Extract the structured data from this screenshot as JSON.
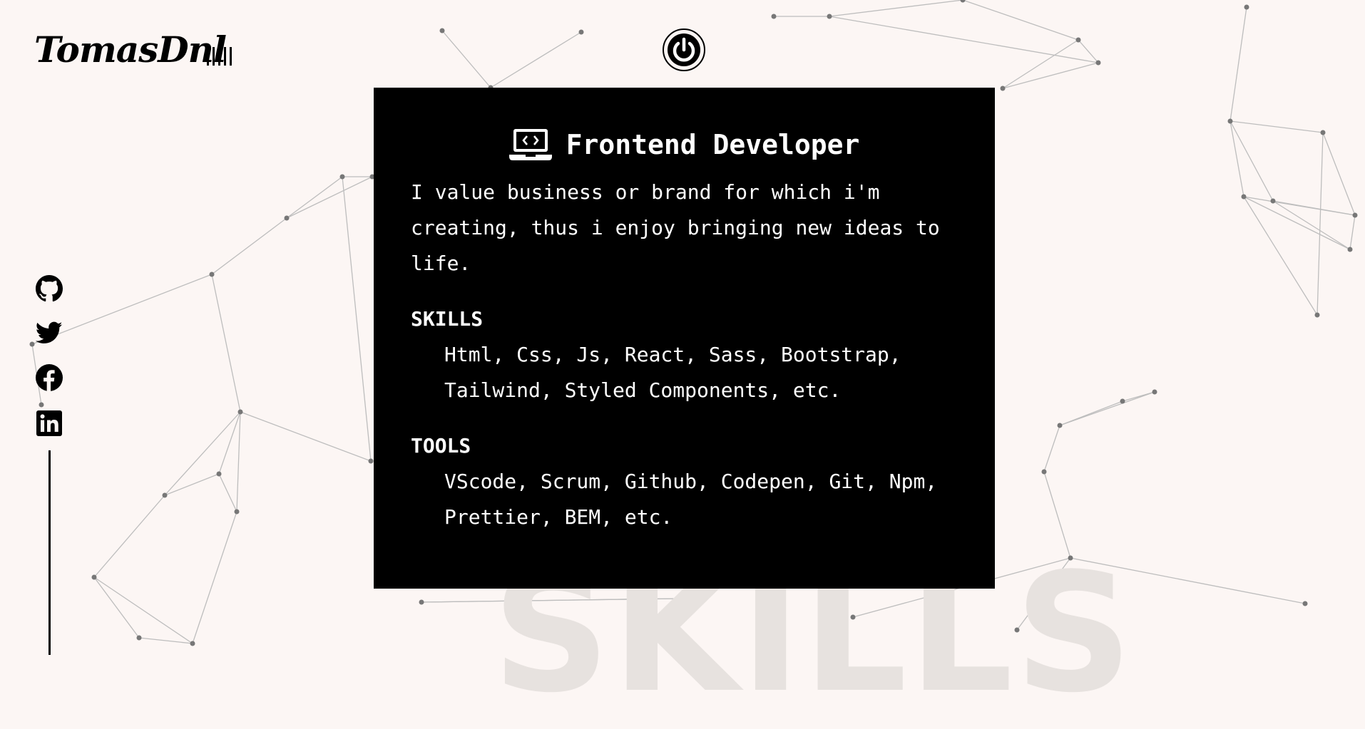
{
  "header": {
    "logo_text": "TomasDnl",
    "bars_count": 5
  },
  "background": {
    "watermark": "SKILLS",
    "network_color": "#bdbdbd",
    "node_color": "#777777"
  },
  "card": {
    "title": "Frontend Developer",
    "title_icon": "laptop-code-icon",
    "intro": "I value business or brand for which i'm creating, thus i enjoy bringing new ideas to life.",
    "skills_heading": "SKILLS",
    "skills": "Html, Css, Js, React, Sass, Bootstrap, Tailwind, Styled Components, etc.",
    "tools_heading": "TOOLS",
    "tools": "VScode, Scrum, Github, Codepen, Git, Npm, Prettier, BEM, etc."
  },
  "social": [
    {
      "icon": "github-icon"
    },
    {
      "icon": "twitter-icon"
    },
    {
      "icon": "facebook-icon"
    },
    {
      "icon": "linkedin-icon"
    }
  ],
  "colors": {
    "background": "#fcf6f4",
    "card": "#000000",
    "text_on_card": "#ffffff"
  }
}
